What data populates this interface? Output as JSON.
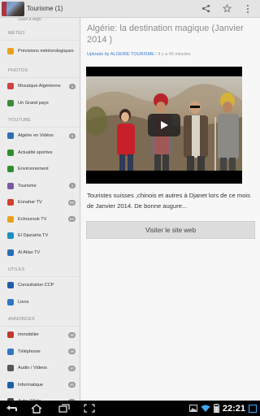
{
  "actionbar": {
    "title": "Tourisme (1)",
    "icons": [
      "app-thumbnail",
      "share-icon",
      "star-icon",
      "overflow-menu-icon"
    ]
  },
  "drawer": {
    "partial_top": "Suivi à Algo",
    "sections": [
      {
        "label": "MÉTÉO",
        "items": [
          {
            "label": "Prévisions météorologiques",
            "badge": "",
            "icon_color": "#e6a21a"
          }
        ]
      },
      {
        "label": "PHOTOS",
        "items": [
          {
            "label": "Mosaïque Algérienne",
            "badge": "1",
            "icon_color": "#c44"
          },
          {
            "label": "Un Grand pays",
            "badge": "",
            "icon_color": "#3c8a3c"
          }
        ]
      },
      {
        "label": "YOUTUBE",
        "items": [
          {
            "label": "Algérie en Vidéos",
            "badge": "6",
            "icon_color": "#2e6fb5"
          },
          {
            "label": "Actualité sportive",
            "badge": "",
            "icon_color": "#2f8f2f"
          },
          {
            "label": "Environnement",
            "badge": "",
            "icon_color": "#2f8f2f"
          },
          {
            "label": "Tourisme",
            "badge": "1",
            "icon_color": "#7a5aa0"
          },
          {
            "label": "Ennahar TV",
            "badge": "99",
            "icon_color": "#d0402b"
          },
          {
            "label": "Echourouk TV",
            "badge": "54",
            "icon_color": "#e6a21a"
          },
          {
            "label": "El Djazaïria TV",
            "badge": "",
            "icon_color": "#1a8fbf"
          },
          {
            "label": "Al Atlas TV",
            "badge": "",
            "icon_color": "#2b6cb0"
          }
        ]
      },
      {
        "label": "UTILES",
        "items": [
          {
            "label": "Consultation CCP",
            "badge": "",
            "icon_color": "#1f5fa8"
          },
          {
            "label": "Liens",
            "badge": "",
            "icon_color": "#2e77c2"
          }
        ]
      },
      {
        "label": "ANNONCES",
        "items": [
          {
            "label": "Immobilier",
            "badge": "35",
            "icon_color": "#c0392b"
          },
          {
            "label": "Téléphonie",
            "badge": "38",
            "icon_color": "#2e77c2"
          },
          {
            "label": "Audio / Videos",
            "badge": "40",
            "icon_color": "#555"
          },
          {
            "label": "Informatique",
            "badge": "40",
            "icon_color": "#1f5fa8"
          },
          {
            "label": "Auto / Moto",
            "badge": "40",
            "icon_color": "#444"
          }
        ]
      }
    ]
  },
  "content": {
    "title": "Algérie: la destination magique (Janvier 2014 )",
    "meta_prefix": "Uploads by",
    "meta_author": "ALGERIE TOURISME",
    "meta_time": " / Il y a 40 minutes",
    "description": "Touristes suisses ,chinois et autres à Djanet lors de ce mois de Janvier 2014. De bonne augure...",
    "visit_button": "Visiter le site web"
  },
  "statusbar": {
    "time": "22:21"
  }
}
